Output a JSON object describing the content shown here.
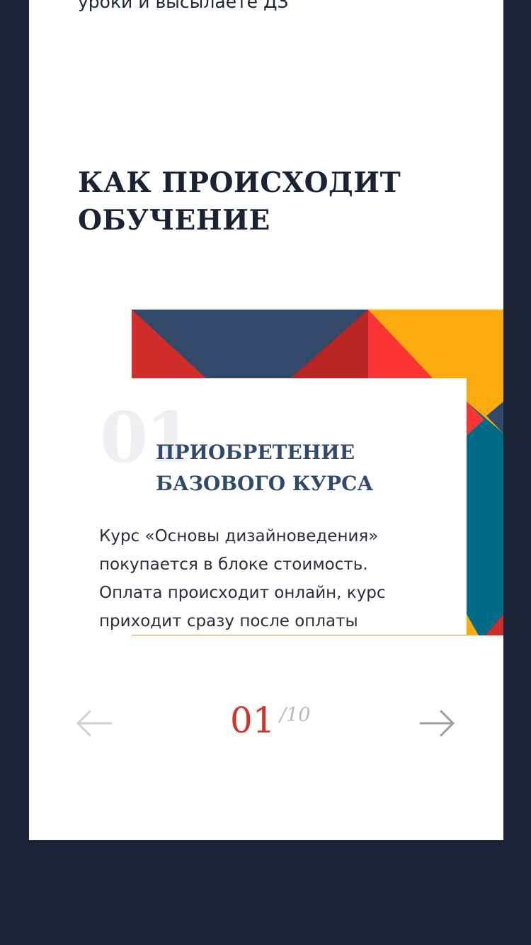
{
  "top_text": "уроки и высылаете ДЗ",
  "section": {
    "title_line1": "КАК ПРОИСХОДИТ",
    "title_line2": "ОБУЧЕНИЕ"
  },
  "slide": {
    "number": "01",
    "title_line1": "ПРИОБРЕТЕНИЕ",
    "title_line2": "БАЗОВОГО КУРСА",
    "description_lines": [
      "Курс «Основы дизайноведения»",
      "покупается в блоке стоимость.",
      "Оплата происходит онлайн, курс",
      "приходит сразу после оплаты"
    ]
  },
  "pagination": {
    "current": "01",
    "total": "/10",
    "prev_icon": "arrow-left-icon",
    "next_icon": "arrow-right-icon"
  },
  "colors": {
    "page_background": "#1a2436",
    "card_background": "#ffffff",
    "title": "#1a2233",
    "step_title": "#2f4a6b",
    "counter_current": "#d6302b",
    "counter_total": "#b8b8be",
    "pattern_navy": "#32496a",
    "pattern_red": "#d12d2b",
    "pattern_yellow": "#fcab0f",
    "pattern_teal": "#006b86"
  }
}
